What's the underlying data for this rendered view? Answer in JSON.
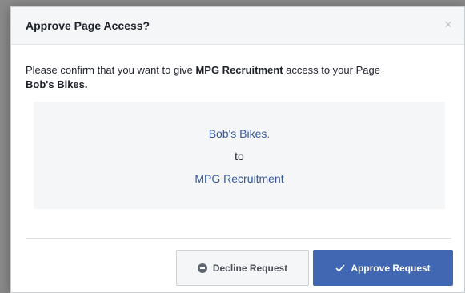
{
  "dialog": {
    "title": "Approve Page Access?",
    "close_glyph": "×",
    "prompt": {
      "prefix": "Please confirm that you want to give ",
      "app_name": "MPG Recruitment",
      "middle": " access to your Page ",
      "page_name": "Bob's Bikes."
    },
    "summary": {
      "page_name": "Bob's Bikes",
      "page_suffix": ".",
      "connector": "to",
      "app_name": "MPG Recruitment"
    },
    "buttons": {
      "decline_label": "Decline Request",
      "approve_label": "Approve Request"
    },
    "icons": {
      "close": "close-icon",
      "decline": "minus-circle-icon",
      "approve": "check-icon"
    },
    "colors": {
      "accent": "#4267b2",
      "link": "#365899",
      "header_bg": "#f5f6f7"
    }
  }
}
